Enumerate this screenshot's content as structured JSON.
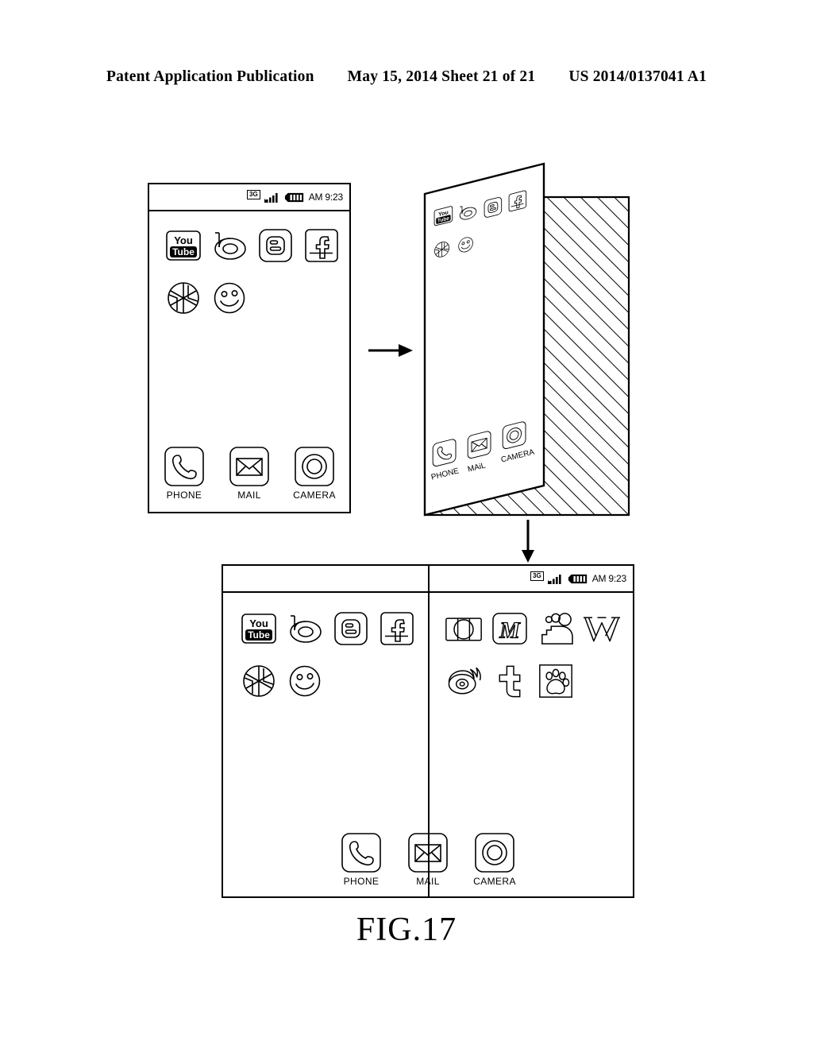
{
  "header": {
    "left": "Patent Application Publication",
    "middle": "May 15, 2014  Sheet 21 of 21",
    "right": "US 2014/0137041 A1"
  },
  "figure": {
    "caption": "FIG.17"
  },
  "status_bar": {
    "network_badge": "3G",
    "signal_icon": "signal-bars-icon",
    "battery_icon": "battery-icon",
    "time": "AM 9:23"
  },
  "phone_single": {
    "name": "single-screen-phone",
    "apps_row1": [
      {
        "id": "youtube",
        "icon": "youtube-icon",
        "label_top": "You",
        "label_bottom": "Tube"
      },
      {
        "id": "bebo",
        "icon": "bebo-b-icon",
        "label_top": "",
        "label_bottom": ""
      },
      {
        "id": "blogger",
        "icon": "blogger-icon",
        "label_top": "",
        "label_bottom": ""
      },
      {
        "id": "facebook",
        "icon": "facebook-f-icon",
        "label_top": "",
        "label_bottom": ""
      }
    ],
    "apps_row2": [
      {
        "id": "picasa",
        "icon": "picasa-pinwheel-icon"
      },
      {
        "id": "smiley",
        "icon": "smiley-face-icon"
      }
    ],
    "dock": [
      {
        "id": "phone",
        "icon": "phone-handset-icon",
        "label": "PHONE"
      },
      {
        "id": "mail",
        "icon": "envelope-icon",
        "label": "MAIL"
      },
      {
        "id": "camera",
        "icon": "camera-lens-icon",
        "label": "CAMERA"
      }
    ]
  },
  "perspective": {
    "name": "folding-screen-perspective",
    "apps_row1": [
      "youtube-icon",
      "bebo-b-icon",
      "blogger-icon",
      "facebook-f-icon"
    ],
    "apps_row2": [
      "picasa-pinwheel-icon",
      "smiley-face-icon"
    ],
    "dock": [
      {
        "id": "phone",
        "icon": "phone-handset-icon",
        "label": "PHONE"
      },
      {
        "id": "mail",
        "icon": "envelope-icon",
        "label": "MAiL"
      },
      {
        "id": "camera",
        "icon": "camera-lens-icon",
        "label": "CAMERA"
      }
    ],
    "hatched_region": "cross-hatched-body"
  },
  "dual_screen": {
    "name": "dual-screen-expanded",
    "left_pane": {
      "apps_row1": [
        {
          "id": "youtube",
          "icon": "youtube-icon",
          "label_top": "You",
          "label_bottom": "Tube"
        },
        {
          "id": "bebo",
          "icon": "bebo-b-icon"
        },
        {
          "id": "blogger",
          "icon": "blogger-icon"
        },
        {
          "id": "facebook",
          "icon": "facebook-f-icon"
        }
      ],
      "apps_row2": [
        {
          "id": "picasa",
          "icon": "picasa-pinwheel-icon"
        },
        {
          "id": "smiley",
          "icon": "smiley-face-icon"
        }
      ]
    },
    "right_pane": {
      "apps_row1": [
        {
          "id": "instagram",
          "icon": "instagram-camera-icon"
        },
        {
          "id": "myspace-m",
          "icon": "letter-m-icon",
          "glyph": "M"
        },
        {
          "id": "people",
          "icon": "people-group-icon"
        },
        {
          "id": "wikipedia",
          "icon": "letter-w-icon",
          "glyph": "W"
        }
      ],
      "apps_row2": [
        {
          "id": "weibo",
          "icon": "flaming-eye-icon"
        },
        {
          "id": "tumblr",
          "icon": "letter-t-icon",
          "glyph": "t"
        },
        {
          "id": "baidu",
          "icon": "paw-print-icon"
        }
      ]
    },
    "dock": [
      {
        "id": "phone",
        "icon": "phone-handset-icon",
        "label": "PHONE"
      },
      {
        "id": "mail",
        "icon": "envelope-icon",
        "label": "MAIL"
      },
      {
        "id": "camera",
        "icon": "camera-lens-icon",
        "label": "CAMERA"
      }
    ]
  },
  "arrows": [
    {
      "id": "arrow-right",
      "direction": "right"
    },
    {
      "id": "arrow-down",
      "direction": "down"
    }
  ]
}
